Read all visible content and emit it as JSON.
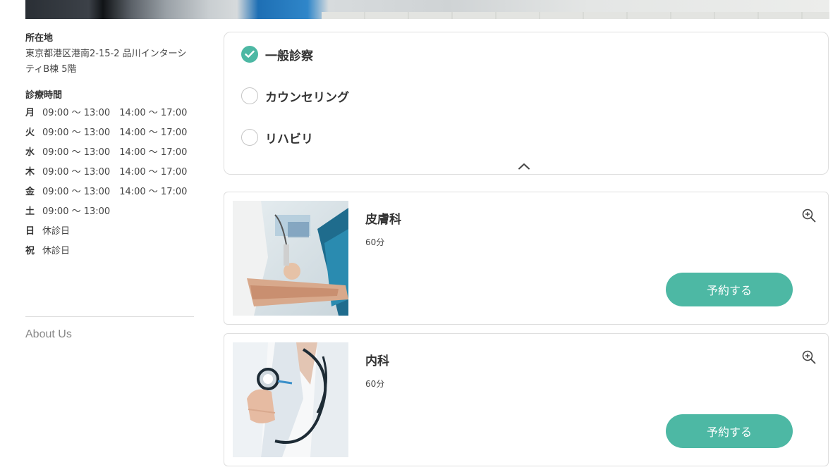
{
  "sidebar": {
    "location_title": "所在地",
    "address": "東京都港区港南2-15-2 品川インターシティB棟 5階",
    "hours_title": "診療時間",
    "hours": [
      {
        "day": "月",
        "time": "09:00 〜 13:00　14:00 〜 17:00"
      },
      {
        "day": "火",
        "time": "09:00 〜 13:00　14:00 〜 17:00"
      },
      {
        "day": "水",
        "time": "09:00 〜 13:00　14:00 〜 17:00"
      },
      {
        "day": "木",
        "time": "09:00 〜 13:00　14:00 〜 17:00"
      },
      {
        "day": "金",
        "time": "09:00 〜 13:00　14:00 〜 17:00"
      },
      {
        "day": "土",
        "time": "09:00 〜 13:00"
      },
      {
        "day": "日",
        "time": "休診日"
      },
      {
        "day": "祝",
        "time": "休診日"
      }
    ],
    "about_link": "About Us"
  },
  "filter": {
    "options": [
      {
        "label": "一般診察",
        "checked": true
      },
      {
        "label": "カウンセリング",
        "checked": false
      },
      {
        "label": "リハビリ",
        "checked": false
      }
    ],
    "toggle_icon": "chevron-up-icon"
  },
  "services": [
    {
      "title": "皮膚科",
      "duration": "60分",
      "button_label": "予約する",
      "image": "doctor-treating-arm-photo",
      "zoom_icon": "zoom-in-icon"
    },
    {
      "title": "内科",
      "duration": "60分",
      "button_label": "予約する",
      "image": "doctor-with-stethoscope-photo",
      "zoom_icon": "zoom-in-icon"
    }
  ],
  "colors": {
    "accent": "#4db8a4",
    "border": "#dedede",
    "muted_text": "#888888"
  }
}
